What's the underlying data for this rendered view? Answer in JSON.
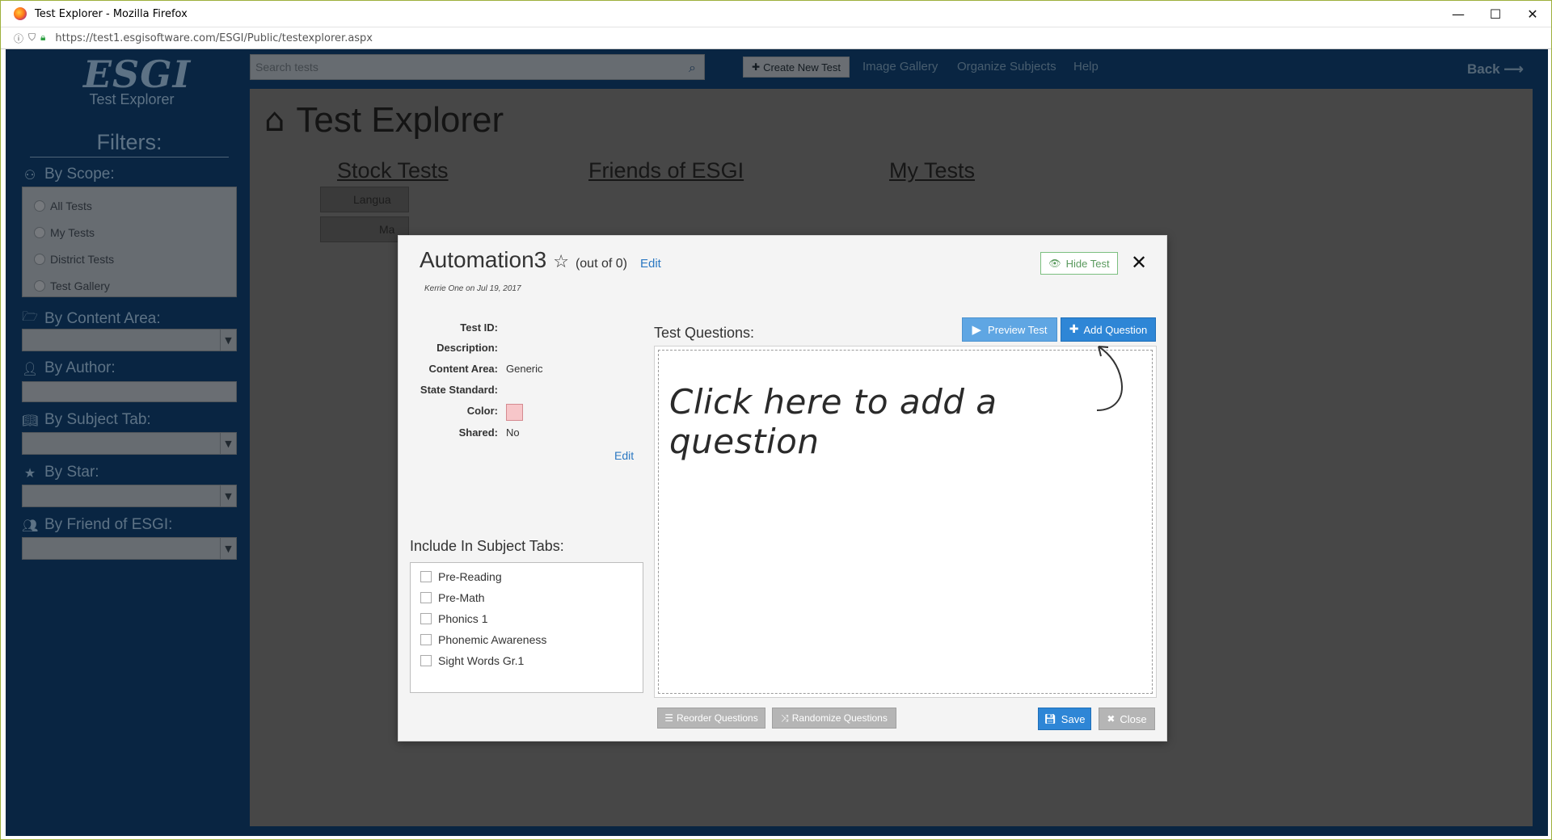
{
  "window": {
    "title": "Test Explorer - Mozilla Firefox",
    "url": "https://test1.esgisoftware.com/ESGI/Public/testexplorer.aspx",
    "controls": {
      "minimize": "—",
      "maximize": "☐",
      "close": "✕"
    }
  },
  "logo": {
    "main": "ESGI",
    "sub": "Test Explorer"
  },
  "filters": {
    "title": "Filters:",
    "scope_label": "By Scope:",
    "scope_options": [
      "All Tests",
      "My Tests",
      "District Tests",
      "Test Gallery"
    ],
    "content_area_label": "By Content Area:",
    "author_label": "By Author:",
    "subject_tab_label": "By Subject Tab:",
    "star_label": "By Star:",
    "friend_label": "By Friend of ESGI:"
  },
  "nav": {
    "search_placeholder": "Search tests",
    "create_label": "Create New Test",
    "image_gallery": "Image Gallery",
    "organize_subjects": "Organize Subjects",
    "help": "Help",
    "back": "Back"
  },
  "content": {
    "title": "Test Explorer",
    "tabs": [
      "Stock Tests",
      "Friends of ESGI",
      "My Tests"
    ],
    "side_tabs": [
      "Langua",
      "Ma"
    ]
  },
  "modal": {
    "title": "Automation3",
    "out_of": "(out of 0)",
    "edit_title": "Edit",
    "author": "Kerrie One on Jul 19, 2017",
    "hide_test": "Hide Test",
    "props": [
      {
        "label": "Test ID:",
        "value": ""
      },
      {
        "label": "Description:",
        "value": ""
      },
      {
        "label": "Content Area:",
        "value": "Generic"
      },
      {
        "label": "State Standard:",
        "value": ""
      },
      {
        "label": "Color:",
        "value": ""
      },
      {
        "label": "Shared:",
        "value": "No"
      }
    ],
    "color_hex": "#f7c6c9",
    "props_edit": "Edit",
    "test_questions_label": "Test Questions:",
    "preview_test": "Preview Test",
    "add_question": "Add Question",
    "click_hint": "Click here to add a question",
    "include_tabs_label": "Include In Subject Tabs:",
    "subject_tabs": [
      "Pre-Reading",
      "Pre-Math",
      "Phonics 1",
      "Phonemic Awareness",
      "Sight Words Gr.1"
    ],
    "reorder": "Reorder Questions",
    "randomize": "Randomize Questions",
    "save": "Save",
    "close": "Close"
  },
  "colors": {
    "app_bg": "#0f3a66",
    "accent": "#2e86d6",
    "link": "#2b78c2"
  }
}
